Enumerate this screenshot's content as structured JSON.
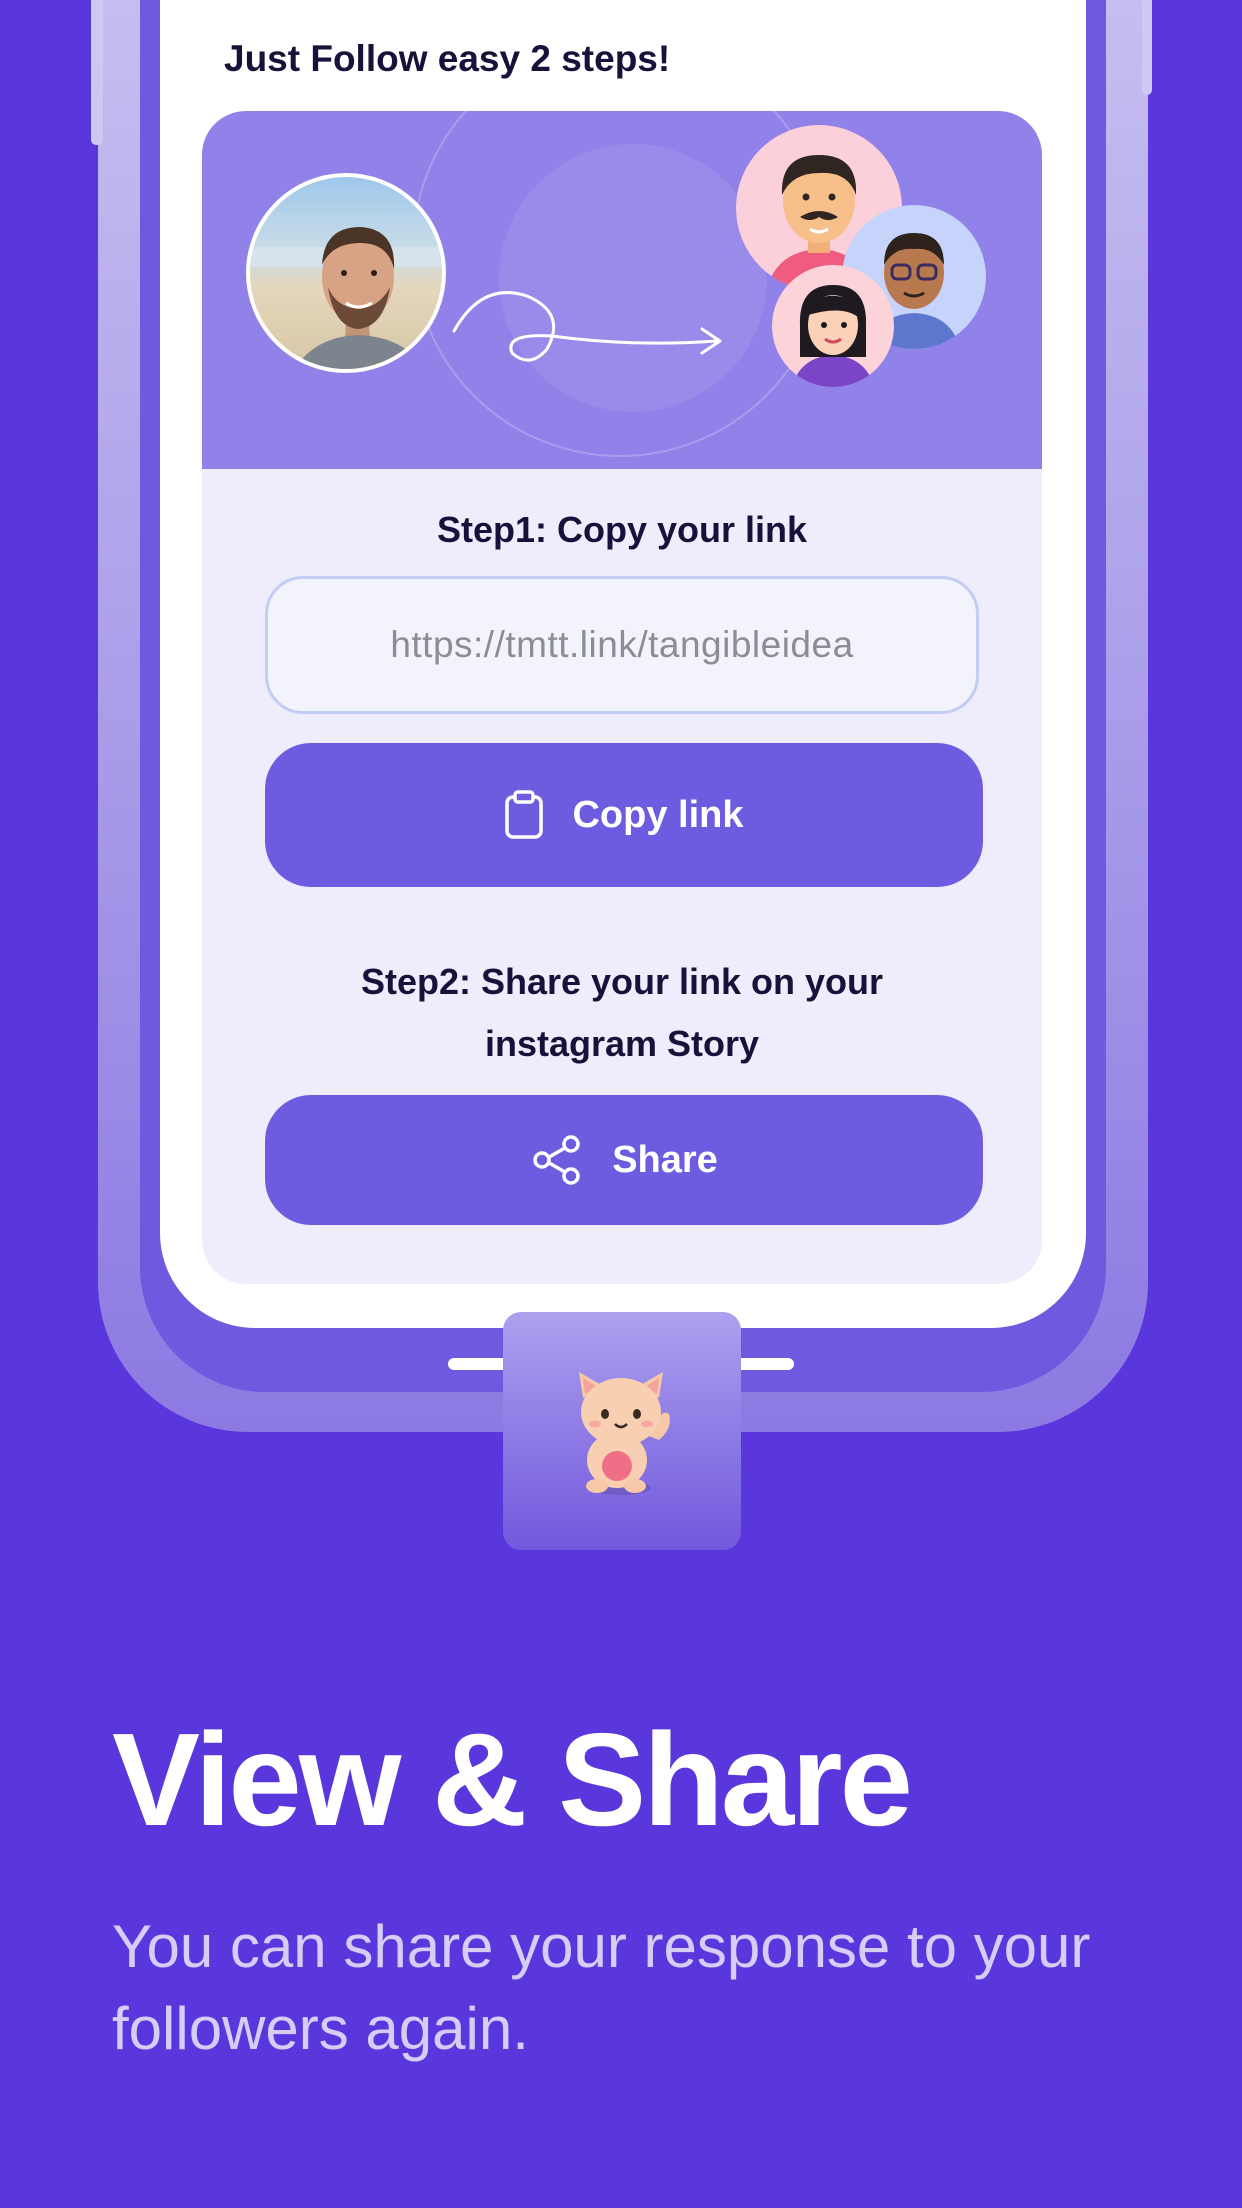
{
  "screen": {
    "heading": "Just Follow easy 2 steps!",
    "step1": {
      "label": "Step1: Copy your link",
      "link_value": "https://tmtt.link/tangibleidea",
      "copy_button_label": "Copy link",
      "copy_icon": "clipboard-icon"
    },
    "step2": {
      "label": "Step2: Share your link on your instagram Story",
      "share_button_label": "Share",
      "share_icon": "share-icon"
    }
  },
  "caption": {
    "title": "View & Share",
    "subtitle": "You can share your response to your followers again."
  },
  "colors": {
    "background": "#5a37dd",
    "accent": "#6e5ce0",
    "banner": "#9082e8",
    "card": "#efedfb"
  }
}
